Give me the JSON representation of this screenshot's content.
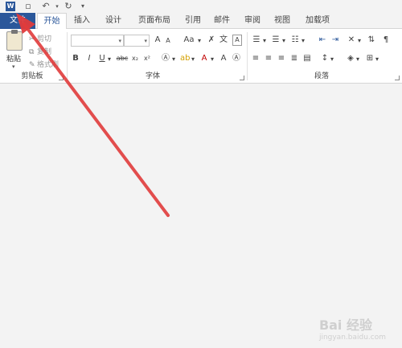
{
  "quick_access": {
    "app_icon": "W",
    "save_icon": "save-icon",
    "undo_icon": "undo-icon",
    "redo_icon": "redo-icon",
    "customize_icon": "customize-icon"
  },
  "tabs": [
    {
      "label": "文件"
    },
    {
      "label": "开始"
    },
    {
      "label": "插入"
    },
    {
      "label": "设计"
    },
    {
      "label": "页面布局"
    },
    {
      "label": "引用"
    },
    {
      "label": "邮件"
    },
    {
      "label": "审阅"
    },
    {
      "label": "视图"
    },
    {
      "label": "加载项"
    }
  ],
  "ribbon": {
    "clipboard": {
      "paste_label": "粘贴",
      "cut_label": "剪切",
      "copy_label": "复制",
      "format_painter_label": "格式刷",
      "group_label": "剪贴板"
    },
    "font": {
      "font_name": "",
      "font_size": "",
      "grow_label": "A",
      "shrink_label": "A",
      "case_label": "Aa",
      "bold_label": "B",
      "italic_label": "I",
      "underline_label": "U",
      "strike_label": "abc",
      "subscript_label": "x₂",
      "superscript_label": "x²",
      "color_label": "A",
      "group_label": "字体"
    },
    "paragraph": {
      "group_label": "段落"
    }
  },
  "colors": {
    "accent": "#2b579a",
    "annotation_arrow": "#e03b3b"
  },
  "watermark": {
    "text": "Bai 经验",
    "sub": "jingyan.baidu.com"
  }
}
